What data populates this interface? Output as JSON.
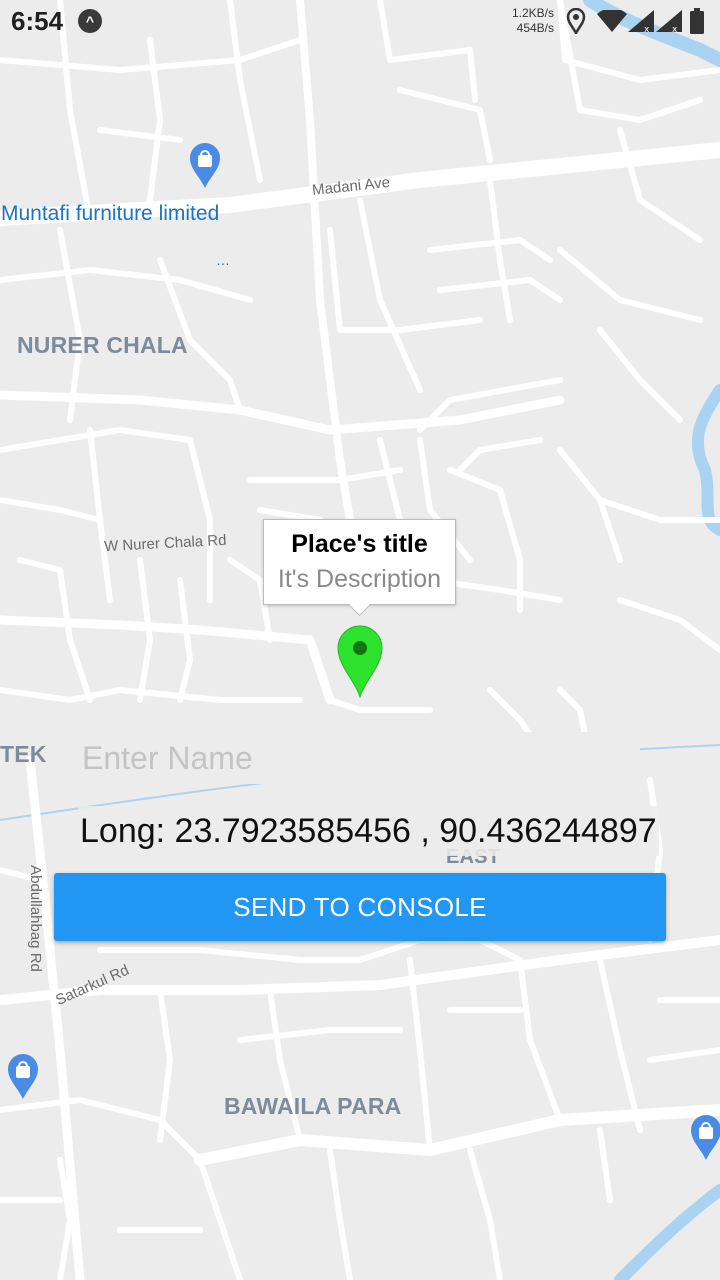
{
  "status_bar": {
    "time": "6:54",
    "upload_speed": "1.2KB/s",
    "download_speed": "454B/s",
    "icons": [
      "app-notification-icon",
      "location-icon",
      "wifi-icon",
      "signal-icon",
      "signal-icon",
      "battery-icon"
    ]
  },
  "map": {
    "areas": [
      "NURER CHALA",
      "BAWAILA PARA",
      "TEK",
      "EAST"
    ],
    "streets": [
      "Madani Ave",
      "W Nurer Chala Rd",
      "Satarkul Rd",
      "Abdullahbag Rd"
    ],
    "pois": [
      {
        "name": "Muntafi furniture limited",
        "icon": "shopping-bag-pin-icon"
      }
    ],
    "colors": {
      "background": "#ececec",
      "road": "#ffffff",
      "water": "#aad3f2",
      "poi": "#1a73c9"
    }
  },
  "info_window": {
    "title": "Place's title",
    "description": "It's Description"
  },
  "marker": {
    "color": "#2ee32e",
    "icon": "map-marker-icon"
  },
  "form": {
    "name_placeholder": "Enter Name",
    "name_value": "",
    "coords_text": "Long: 23.7923585456 , 90.436244897",
    "send_label": "SEND TO CONSOLE",
    "button_color": "#2196f3"
  }
}
